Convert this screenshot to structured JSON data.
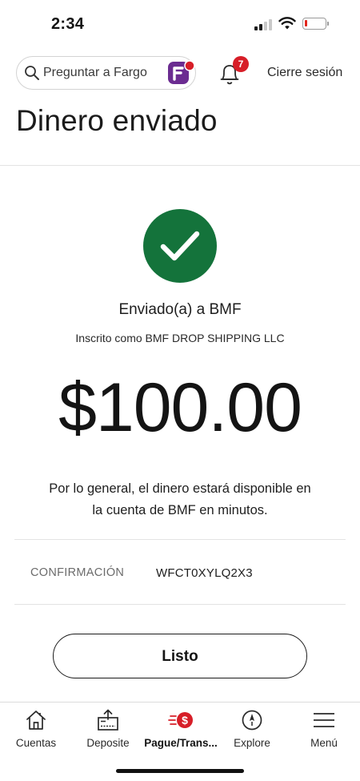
{
  "status_bar": {
    "time": "2:34"
  },
  "header": {
    "search_placeholder": "Preguntar a Fargo",
    "notification_count": "7",
    "signout_label": "Cierre sesión"
  },
  "page": {
    "title": "Dinero enviado"
  },
  "confirmation": {
    "sent_to": "Enviado(a) a BMF",
    "enrolled_as": "Inscrito como BMF DROP SHIPPING LLC",
    "amount": "$100.00",
    "availability_line1": "Por lo general, el dinero estará disponible en",
    "availability_line2": "la cuenta de BMF en minutos.",
    "confirmation_label": "CONFIRMACIÓN",
    "confirmation_number": "WFCT0XYLQ2X3",
    "done_label": "Listo"
  },
  "bottom_nav": {
    "items": [
      {
        "label": "Cuentas",
        "icon": "house-icon"
      },
      {
        "label": "Deposite",
        "icon": "deposit-icon"
      },
      {
        "label": "Pague/Trans...",
        "icon": "pay-transfer-icon",
        "active": true
      },
      {
        "label": "Explore",
        "icon": "compass-icon"
      },
      {
        "label": "Menú",
        "icon": "menu-icon"
      }
    ]
  },
  "colors": {
    "success_green": "#14733b",
    "badge_red": "#d71e28",
    "brand_purple": "#6b2c91",
    "battery_red": "#e1261c"
  }
}
